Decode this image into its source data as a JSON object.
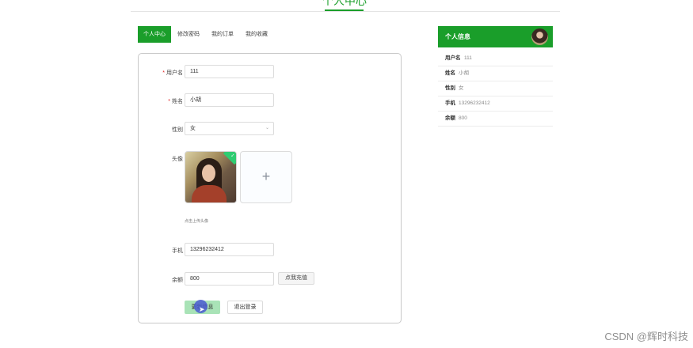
{
  "page": {
    "title": "个人中心"
  },
  "tabs": [
    {
      "label": "个人中心",
      "active": true
    },
    {
      "label": "修改密码",
      "active": false
    },
    {
      "label": "我的订单",
      "active": false
    },
    {
      "label": "我的收藏",
      "active": false
    }
  ],
  "form": {
    "username": {
      "label": "用户名",
      "required": true,
      "value": "111"
    },
    "name": {
      "label": "姓名",
      "required": true,
      "value": "小胡"
    },
    "gender": {
      "label": "性别",
      "value": "女"
    },
    "avatar": {
      "label": "头像",
      "hint": "点击上传头像"
    },
    "phone": {
      "label": "手机",
      "value": "13296232412"
    },
    "balance": {
      "label": "余额",
      "value": "800",
      "recharge_label": "点我充值"
    },
    "save_label": "更新信息",
    "logout_label": "退出登录"
  },
  "info": {
    "title": "个人信息",
    "rows": [
      {
        "key": "用户名",
        "value": "111"
      },
      {
        "key": "姓名",
        "value": "小胡"
      },
      {
        "key": "性别",
        "value": "女"
      },
      {
        "key": "手机",
        "value": "13296232412"
      },
      {
        "key": "余额",
        "value": "800"
      }
    ]
  },
  "watermark": "CSDN @辉时科技",
  "colors": {
    "accent": "#1a9e2a",
    "save_button": "#a9e3b7",
    "required": "#e02020"
  }
}
